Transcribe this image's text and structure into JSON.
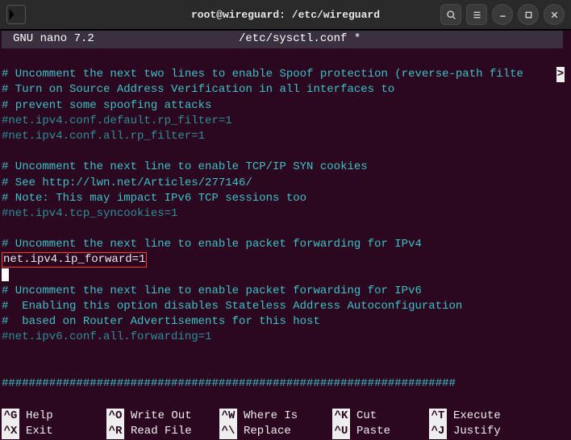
{
  "window": {
    "title": "root@wireguard: /etc/wireguard",
    "icons": {
      "terminal": "terminal-icon",
      "search": "search-icon",
      "menu": "hamburger-icon",
      "minimize": "minimize-icon",
      "maximize": "maximize-icon",
      "close": "close-icon"
    }
  },
  "editor": {
    "app": "GNU nano 7.2",
    "file": "/etc/sysctl.conf *",
    "overflow_marker": ">",
    "lines": [
      {
        "cls": "blank",
        "text": ""
      },
      {
        "cls": "cmt",
        "text": "# Uncomment the next two lines to enable Spoof protection (reverse-path filte",
        "overflow": true
      },
      {
        "cls": "cmt",
        "text": "# Turn on Source Address Verification in all interfaces to"
      },
      {
        "cls": "cmt",
        "text": "# prevent some spoofing attacks"
      },
      {
        "cls": "cmtd",
        "text": "#net.ipv4.conf.default.rp_filter=1"
      },
      {
        "cls": "cmtd",
        "text": "#net.ipv4.conf.all.rp_filter=1"
      },
      {
        "cls": "blank",
        "text": ""
      },
      {
        "cls": "cmt",
        "text": "# Uncomment the next line to enable TCP/IP SYN cookies"
      },
      {
        "cls": "cmt",
        "text": "# See http://lwn.net/Articles/277146/"
      },
      {
        "cls": "cmt",
        "text": "# Note: This may impact IPv6 TCP sessions too"
      },
      {
        "cls": "cmtd",
        "text": "#net.ipv4.tcp_syncookies=1"
      },
      {
        "cls": "blank",
        "text": ""
      },
      {
        "cls": "cmt",
        "text": "# Uncomment the next line to enable packet forwarding for IPv4"
      },
      {
        "cls": "plain",
        "hl": true,
        "text": "net.ipv4.ip_forward=1"
      },
      {
        "cls": "cursor",
        "text": ""
      },
      {
        "cls": "cmt",
        "text": "# Uncomment the next line to enable packet forwarding for IPv6"
      },
      {
        "cls": "cmt",
        "text": "#  Enabling this option disables Stateless Address Autoconfiguration"
      },
      {
        "cls": "cmt",
        "text": "#  based on Router Advertisements for this host"
      },
      {
        "cls": "cmtd",
        "text": "#net.ipv6.conf.all.forwarding=1"
      },
      {
        "cls": "blank",
        "text": ""
      },
      {
        "cls": "blank",
        "text": ""
      },
      {
        "cls": "hashrow",
        "text": "###################################################################"
      }
    ]
  },
  "shortcuts": [
    {
      "key": "^G",
      "label": "Help"
    },
    {
      "key": "^O",
      "label": "Write Out"
    },
    {
      "key": "^W",
      "label": "Where Is"
    },
    {
      "key": "^K",
      "label": "Cut"
    },
    {
      "key": "^T",
      "label": "Execute"
    },
    {
      "key": "^X",
      "label": "Exit"
    },
    {
      "key": "^R",
      "label": "Read File"
    },
    {
      "key": "^\\",
      "label": "Replace"
    },
    {
      "key": "^U",
      "label": "Paste"
    },
    {
      "key": "^J",
      "label": "Justify"
    }
  ]
}
